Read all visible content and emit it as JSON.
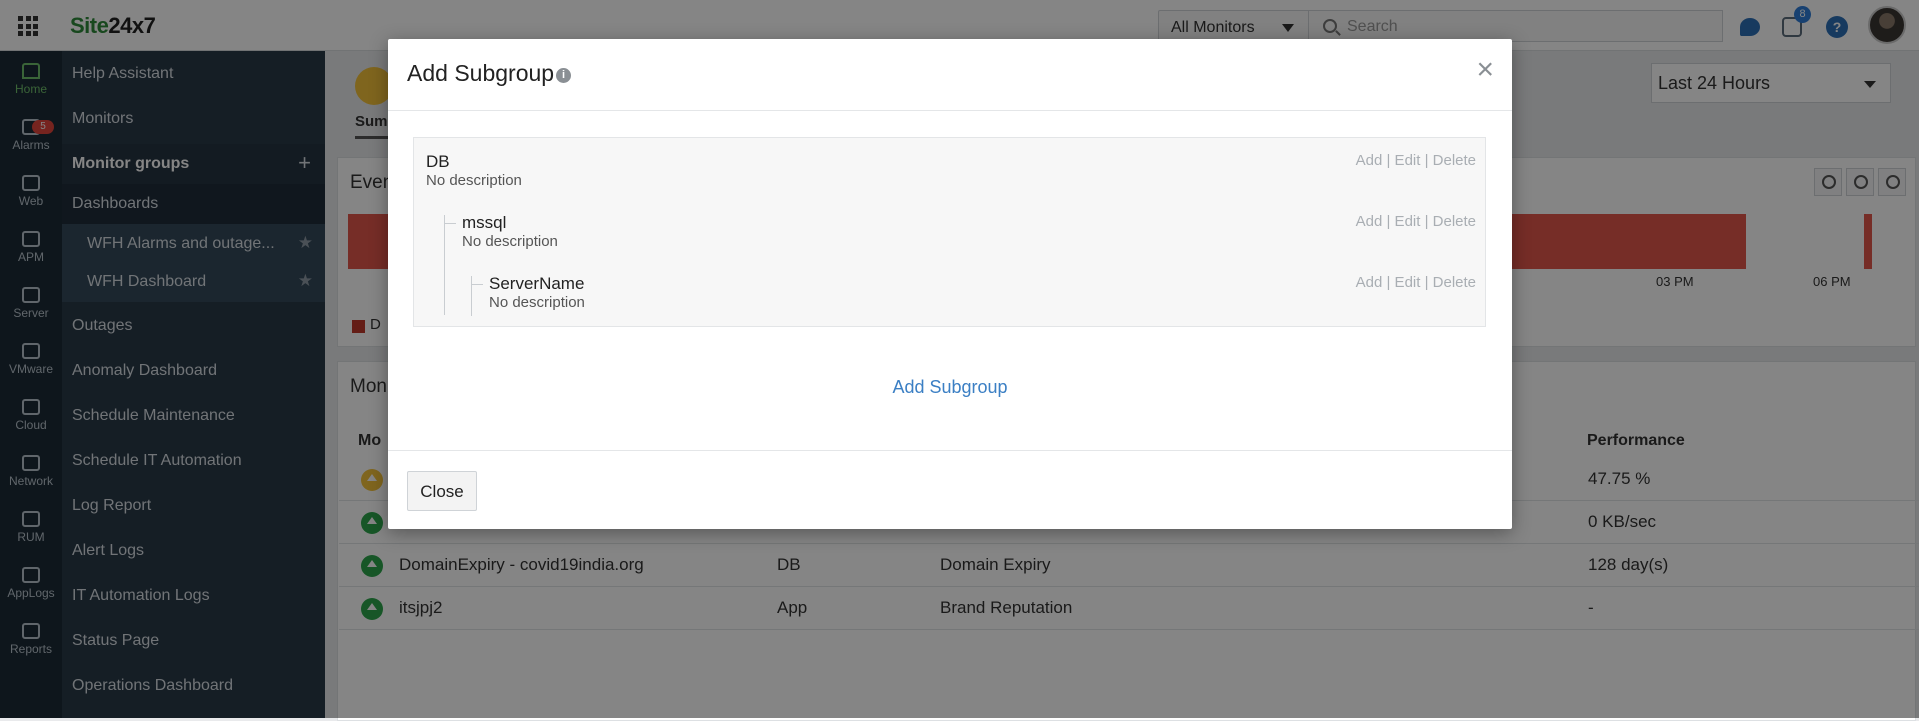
{
  "brand": {
    "logo_part1": "Site",
    "logo_part2": "24x7",
    "logo_color": "#2e8b3a"
  },
  "topbar": {
    "monitor_filter": "All Monitors",
    "search_placeholder": "Search",
    "notification_count": "8",
    "help_glyph": "?"
  },
  "rail": {
    "items": [
      "Home",
      "Alarms",
      "Web",
      "APM",
      "Server",
      "VMware",
      "Cloud",
      "Network",
      "RUM",
      "AppLogs",
      "Reports"
    ],
    "alarm_badge": "5"
  },
  "nav": {
    "items": [
      "Help Assistant",
      "Monitors",
      "Monitor groups",
      "Dashboards",
      "WFH Alarms and outage...",
      "WFH Dashboard",
      "Outages",
      "Anomaly Dashboard",
      "Schedule Maintenance",
      "Schedule IT Automation",
      "Log Report",
      "Alert Logs",
      "IT Automation Logs",
      "Status Page",
      "Operations Dashboard"
    ],
    "plus_glyph": "+",
    "star_glyph": "★"
  },
  "background": {
    "tab_summary": "Summ",
    "time_range": "Last 24 Hours",
    "events_title": "Even",
    "axis_labels": [
      "03 PM",
      "06 PM"
    ],
    "legend_text": "D",
    "monitors_title": "Mon",
    "col_monitor": "Mo",
    "col_performance": "Performance",
    "rows": [
      {
        "name": "",
        "group": "",
        "type": "",
        "performance": "47.75 %",
        "status": "warn"
      },
      {
        "name": "",
        "group": "",
        "type": "",
        "performance": "0 KB/sec",
        "status": "up"
      },
      {
        "name": "DomainExpiry - covid19india.org",
        "group": "DB",
        "type": "Domain Expiry",
        "performance": "128 day(s)",
        "status": "up"
      },
      {
        "name": "itsjpj2",
        "group": "App",
        "type": "Brand Reputation",
        "performance": "-",
        "status": "up"
      }
    ]
  },
  "modal": {
    "title": "Add Subgroup",
    "info_glyph": "i",
    "close_glyph": "×",
    "nodes": [
      {
        "name": "DB",
        "description": "No description",
        "actions": "Add | Edit | Delete"
      },
      {
        "name": "mssql",
        "description": "No description",
        "actions": "Add | Edit | Delete"
      },
      {
        "name": "ServerName",
        "description": "No description",
        "actions": "Add | Edit | Delete"
      }
    ],
    "add_link": "Add Subgroup",
    "close_button": "Close"
  },
  "colors": {
    "link": "#3b7fc4",
    "sidebar": "#2a3a48",
    "rail": "#1c2b36",
    "error_bar": "#e2574c",
    "up_status": "#2ca54b",
    "warn_status": "#f3c13a"
  }
}
